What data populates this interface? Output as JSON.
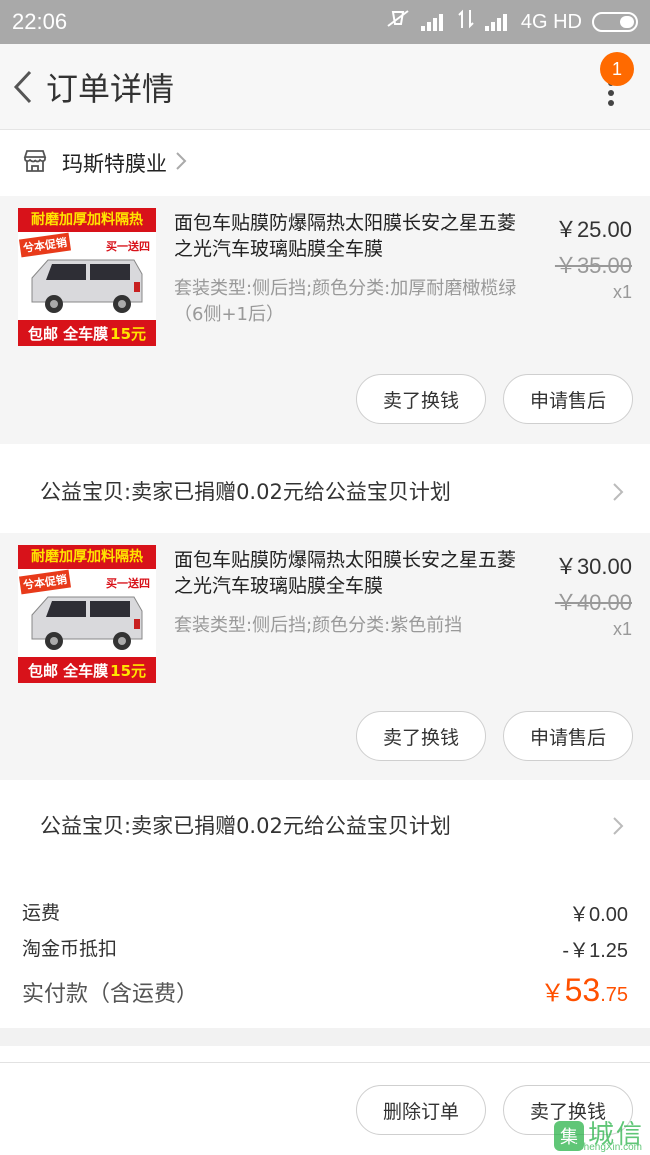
{
  "status_bar": {
    "time": "22:06",
    "network": "4G HD"
  },
  "nav": {
    "title": "订单详情",
    "badge_count": "1"
  },
  "shop": {
    "name": "玛斯特膜业"
  },
  "items": [
    {
      "thumb_top": "耐磨加厚加料隔热",
      "thumb_promo": "兮本促销",
      "thumb_gift": "买一送四",
      "thumb_bottom_a": "包邮 全车膜",
      "thumb_bottom_b": "15元",
      "title": "面包车贴膜防爆隔热太阳膜长安之星五菱之光汽车玻璃贴膜全车膜",
      "spec": "套装类型:侧后挡;颜色分类:加厚耐磨橄榄绿（6侧+1后）",
      "price": "￥25.00",
      "old_price": "￥35.00",
      "qty": "x1",
      "btn_sell": "卖了换钱",
      "btn_aftersale": "申请售后"
    },
    {
      "thumb_top": "耐磨加厚加料隔热",
      "thumb_promo": "兮本促销",
      "thumb_gift": "买一送四",
      "thumb_bottom_a": "包邮 全车膜",
      "thumb_bottom_b": "15元",
      "title": "面包车贴膜防爆隔热太阳膜长安之星五菱之光汽车玻璃贴膜全车膜",
      "spec": "套装类型:侧后挡;颜色分类:紫色前挡",
      "price": "￥30.00",
      "old_price": "￥40.00",
      "qty": "x1",
      "btn_sell": "卖了换钱",
      "btn_aftersale": "申请售后"
    }
  ],
  "charity_text": "公益宝贝:卖家已捐赠0.02元给公益宝贝计划",
  "summary": {
    "shipping_label": "运费",
    "shipping_value": "￥0.00",
    "coin_label": "淘金币抵扣",
    "coin_value": "-￥1.25",
    "total_label": "实付款（含运费）",
    "total_currency": "￥",
    "total_int": "53",
    "total_dec": ".75"
  },
  "bottom": {
    "btn_delete": "删除订单",
    "btn_sell": "卖了换钱"
  },
  "watermark": {
    "logo": "集",
    "cn": "城信",
    "en": "JiChengXin.com"
  },
  "colors": {
    "accent": "#ff5000",
    "badge": "#ff6a00",
    "status_bar": "#a9a9a9"
  }
}
